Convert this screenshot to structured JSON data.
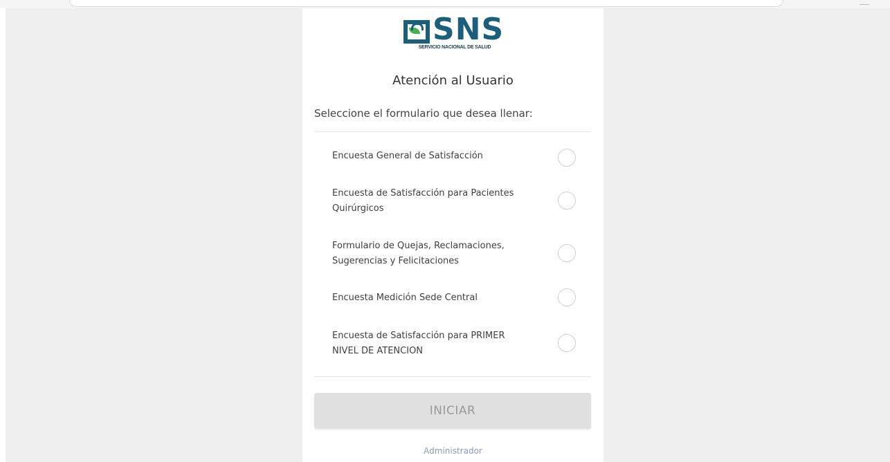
{
  "logo": {
    "wordmark": "SNS",
    "subtitle": "SERVICIO NACIONAL DE SALUD"
  },
  "page": {
    "title": "Atención al Usuario",
    "instruction": "Seleccione el formulario que desea llenar:"
  },
  "options": [
    {
      "label": "Encuesta General de Satisfacción"
    },
    {
      "label": "Encuesta de Satisfacción para Pacientes Quirúrgicos"
    },
    {
      "label": "Formulario de Quejas, Reclamaciones, Sugerencias y Felicitaciones"
    },
    {
      "label": "Encuesta Medición Sede Central"
    },
    {
      "label": "Encuesta de Satisfacción para PRIMER NIVEL DE ATENCION"
    }
  ],
  "actions": {
    "start_label": "INICIAR",
    "admin_link": "Administrador"
  },
  "colors": {
    "brand": "#1d5e7a",
    "leaf": "#4caf50",
    "button_disabled_bg": "#e0e0e0",
    "page_bg": "#efefef"
  }
}
